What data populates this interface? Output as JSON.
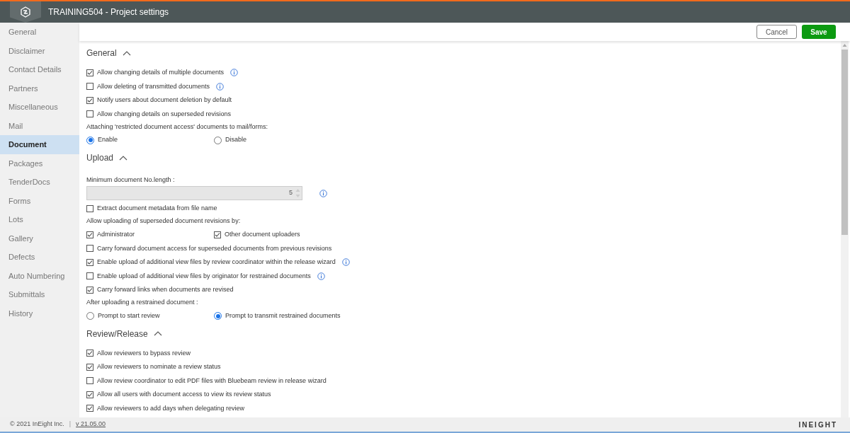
{
  "window": {
    "title": "TRAINING504 - Project settings"
  },
  "sidebar": {
    "items": [
      {
        "label": "General",
        "selected": false
      },
      {
        "label": "Disclaimer",
        "selected": false
      },
      {
        "label": "Contact Details",
        "selected": false
      },
      {
        "label": "Partners",
        "selected": false
      },
      {
        "label": "Miscellaneous",
        "selected": false
      },
      {
        "label": "Mail",
        "selected": false
      },
      {
        "label": "Document",
        "selected": true
      },
      {
        "label": "Packages",
        "selected": false
      },
      {
        "label": "TenderDocs",
        "selected": false
      },
      {
        "label": "Forms",
        "selected": false
      },
      {
        "label": "Lots",
        "selected": false
      },
      {
        "label": "Gallery",
        "selected": false
      },
      {
        "label": "Defects",
        "selected": false
      },
      {
        "label": "Auto Numbering",
        "selected": false
      },
      {
        "label": "Submittals",
        "selected": false
      },
      {
        "label": "History",
        "selected": false
      }
    ]
  },
  "toolbar": {
    "buttons": [
      {
        "label": "Cancel",
        "kind": "secondary"
      },
      {
        "label": "Save",
        "kind": "primary"
      }
    ]
  },
  "sections": [
    {
      "title": "General",
      "expanded": true,
      "items": [
        {
          "kind": "checkbox",
          "label": "Allow changing details of multiple documents",
          "checked": true,
          "info": true
        },
        {
          "kind": "checkbox",
          "label": "Allow deleting of transmitted documents",
          "checked": false,
          "info": true
        },
        {
          "kind": "checkbox",
          "label": "Notify users about document deletion by default",
          "checked": true,
          "info": false
        },
        {
          "kind": "checkbox",
          "label": "Allow changing details on superseded revisions",
          "checked": false,
          "info": false
        },
        {
          "kind": "label",
          "label": "Attaching 'restricted document access' documents to mail/forms:"
        },
        {
          "kind": "radios",
          "options": [
            {
              "label": "Enable",
              "selected": true
            },
            {
              "label": "Disable",
              "selected": false
            }
          ]
        }
      ]
    },
    {
      "title": "Upload",
      "expanded": true,
      "items": [
        {
          "kind": "number",
          "label": "Minimum document No.length :",
          "value": "5",
          "disabled": true,
          "info": true
        },
        {
          "kind": "checkbox",
          "label": "Extract document metadata from file name",
          "checked": false,
          "info": false
        },
        {
          "kind": "label",
          "label": "Allow uploading of superseded document revisions by:"
        },
        {
          "kind": "checkpair",
          "options": [
            {
              "label": "Administrator",
              "checked": true
            },
            {
              "label": "Other document uploaders",
              "checked": true
            }
          ]
        },
        {
          "kind": "checkbox",
          "label": "Carry forward document access for superseded documents from previous revisions",
          "checked": false,
          "info": false
        },
        {
          "kind": "checkbox",
          "label": "Enable upload of additional view files by review coordinator within the release wizard",
          "checked": true,
          "info": true
        },
        {
          "kind": "checkbox",
          "label": "Enable upload of additional view files by originator for restrained documents",
          "checked": false,
          "info": true
        },
        {
          "kind": "checkbox",
          "label": "Carry forward links when documents are revised",
          "checked": true,
          "info": false
        },
        {
          "kind": "label",
          "label": "After uploading a restrained document :"
        },
        {
          "kind": "radios",
          "options": [
            {
              "label": "Prompt to start review",
              "selected": false
            },
            {
              "label": "Prompt to transmit restrained documents",
              "selected": true
            }
          ]
        }
      ]
    },
    {
      "title": "Review/Release",
      "expanded": true,
      "items": [
        {
          "kind": "checkbox",
          "label": "Allow reviewers to bypass review",
          "checked": true,
          "info": false
        },
        {
          "kind": "checkbox",
          "label": "Allow reviewers to nominate a review status",
          "checked": true,
          "info": false
        },
        {
          "kind": "checkbox",
          "label": "Allow review coordinator to edit PDF files with Bluebeam review in release wizard",
          "checked": false,
          "info": false
        },
        {
          "kind": "checkbox",
          "label": "Allow all users with document access to view its review status",
          "checked": true,
          "info": false
        },
        {
          "kind": "checkbox",
          "label": "Allow reviewers to add days when delegating review",
          "checked": true,
          "info": false
        }
      ]
    }
  ],
  "footer": {
    "copyright": "© 2021 InEight Inc.",
    "separator": "|",
    "version": "v 21.05.00",
    "brand": "INEIGHT"
  }
}
